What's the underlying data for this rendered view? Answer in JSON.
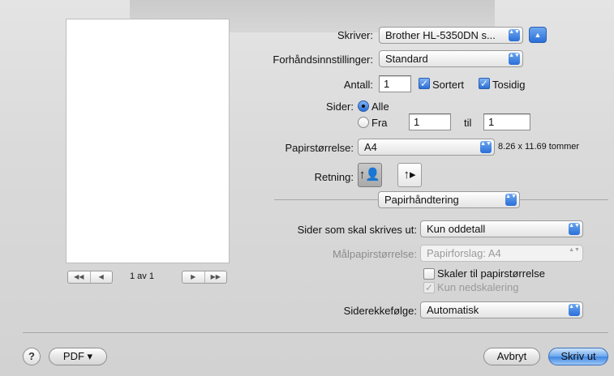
{
  "printer": {
    "label": "Skriver:",
    "value": "Brother HL-5350DN s...",
    "expand": "▲"
  },
  "presets": {
    "label": "Forhåndsinnstillinger:",
    "value": "Standard"
  },
  "copies": {
    "label": "Antall:",
    "value": "1",
    "collated": "Sortert",
    "duplex": "Tosidig"
  },
  "pages": {
    "label": "Sider:",
    "all": "Alle",
    "from": "Fra",
    "from_value": "1",
    "to": "til",
    "to_value": "1"
  },
  "paper_size": {
    "label": "Papirstørrelse:",
    "value": "A4",
    "dimensions": "8.26 x 11.69 tommer"
  },
  "orientation": {
    "label": "Retning:",
    "portrait_icon": "↑👤",
    "landscape_icon": "↑▸"
  },
  "section": {
    "value": "Papirhåndtering"
  },
  "pages_to_print": {
    "label": "Sider som skal skrives ut:",
    "value": "Kun oddetall"
  },
  "destination_size": {
    "label": "Målpapirstørrelse:",
    "value": "Papirforslag: A4"
  },
  "scale_to_fit": {
    "label": "Skaler til papirstørrelse"
  },
  "scale_down_only": {
    "label": "Kun nedskalering"
  },
  "page_order": {
    "label": "Siderekkefølge:",
    "value": "Automatisk"
  },
  "preview_nav": {
    "first": "◀◀",
    "prev": "◀",
    "next": "▶",
    "last": "▶▶",
    "page_info": "1 av 1"
  },
  "footer": {
    "help": "?",
    "pdf": "PDF ▾",
    "cancel": "Avbryt",
    "print": "Skriv ut"
  },
  "icons": {
    "popup_arrows": "▲▼",
    "check": "✓"
  }
}
